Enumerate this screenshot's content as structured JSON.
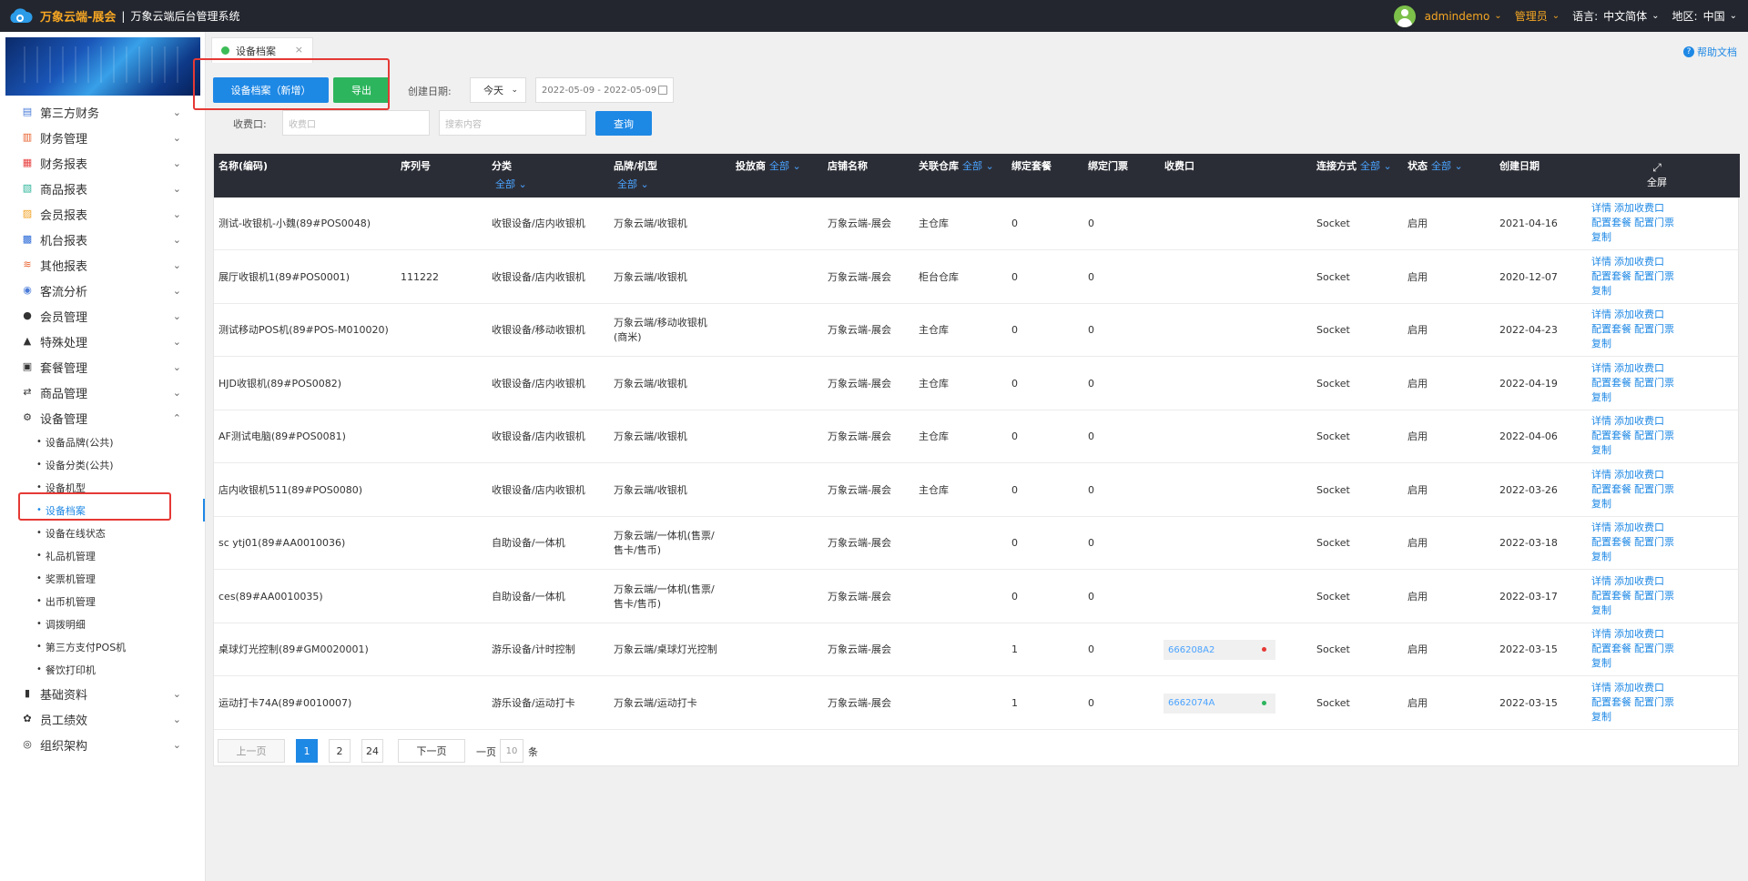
{
  "header": {
    "brand": "万象云端-展会",
    "separator": "|",
    "system_name": "万象云端后台管理系统",
    "username": "admindemo",
    "role": "管理员",
    "language_label": "语言:",
    "language": "中文简体",
    "region_label": "地区:",
    "region": "中国"
  },
  "sidebar": {
    "items": [
      {
        "label": "第三方财务",
        "icon": "document-icon",
        "color": "#4a7bd8"
      },
      {
        "label": "财务管理",
        "icon": "ledger-icon",
        "color": "#e8602c"
      },
      {
        "label": "财务报表",
        "icon": "report-icon",
        "color": "#e84040"
      },
      {
        "label": "商品报表",
        "icon": "product-report-icon",
        "color": "#2db59a"
      },
      {
        "label": "会员报表",
        "icon": "member-report-icon",
        "color": "#f0a020"
      },
      {
        "label": "机台报表",
        "icon": "machine-report-icon",
        "color": "#2c6bd8"
      },
      {
        "label": "其他报表",
        "icon": "layers-icon",
        "color": "#e8602c"
      },
      {
        "label": "客流分析",
        "icon": "target-icon",
        "color": "#4a7bd8"
      },
      {
        "label": "会员管理",
        "icon": "user-icon",
        "color": "#333"
      },
      {
        "label": "特殊处理",
        "icon": "warning-icon",
        "color": "#333"
      },
      {
        "label": "套餐管理",
        "icon": "package-icon",
        "color": "#333"
      },
      {
        "label": "商品管理",
        "icon": "swap-icon",
        "color": "#333"
      },
      {
        "label": "设备管理",
        "icon": "device-icon",
        "color": "#333"
      }
    ],
    "sub_items": [
      "设备品牌(公共)",
      "设备分类(公共)",
      "设备机型",
      "设备档案",
      "设备在线状态",
      "礼品机管理",
      "奖票机管理",
      "出币机管理",
      "调拨明细",
      "第三方支付POS机",
      "餐饮打印机"
    ],
    "bottom_items": [
      {
        "label": "基础资料",
        "icon": "book-icon"
      },
      {
        "label": "员工绩效",
        "icon": "gear-icon"
      },
      {
        "label": "组织架构",
        "icon": "org-icon"
      }
    ]
  },
  "tabs": {
    "active": "设备档案",
    "close": "×"
  },
  "help": "帮助文档",
  "toolbar": {
    "add_label": "设备档案（新增）",
    "export_label": "导出",
    "created_label": "创建日期:",
    "date_preset": "今天",
    "date_range": "2022-05-09 - 2022-05-09",
    "port_label": "收费口:",
    "port_placeholder": "收费口",
    "search_placeholder": "搜索内容",
    "query_label": "查询"
  },
  "table": {
    "headers": {
      "name": "名称(编码)",
      "serial": "序列号",
      "category": "分类",
      "brand": "品牌/机型",
      "operator": "投放商",
      "store": "店铺名称",
      "warehouse": "关联仓库",
      "bind_package": "绑定套餐",
      "bind_ticket": "绑定门票",
      "port": "收费口",
      "conn": "连接方式",
      "status": "状态",
      "created": "创建日期",
      "fullscreen": "全屏",
      "all": "全部"
    },
    "rows": [
      {
        "name": "测试-收银机-小魏(89#POS0048)",
        "serial": "",
        "category": "收银设备/店内收银机",
        "brand": "万象云端/收银机",
        "store": "万象云端-展会",
        "warehouse": "主仓库",
        "pkg": "0",
        "ticket": "0",
        "port": "",
        "conn": "Socket",
        "status": "启用",
        "created": "2021-04-16"
      },
      {
        "name": "展厅收银机1(89#POS0001)",
        "serial": "111222",
        "category": "收银设备/店内收银机",
        "brand": "万象云端/收银机",
        "store": "万象云端-展会",
        "warehouse": "柜台仓库",
        "pkg": "0",
        "ticket": "0",
        "port": "",
        "conn": "Socket",
        "status": "启用",
        "created": "2020-12-07"
      },
      {
        "name": "测试移动POS机(89#POS-M010020)",
        "serial": "",
        "category": "收银设备/移动收银机",
        "brand": "万象云端/移动收银机\n(商米)",
        "store": "万象云端-展会",
        "warehouse": "主仓库",
        "pkg": "0",
        "ticket": "0",
        "port": "",
        "conn": "Socket",
        "status": "启用",
        "created": "2022-04-23"
      },
      {
        "name": "HJD收银机(89#POS0082)",
        "serial": "",
        "category": "收银设备/店内收银机",
        "brand": "万象云端/收银机",
        "store": "万象云端-展会",
        "warehouse": "主仓库",
        "pkg": "0",
        "ticket": "0",
        "port": "",
        "conn": "Socket",
        "status": "启用",
        "created": "2022-04-19"
      },
      {
        "name": "AF测试电脑(89#POS0081)",
        "serial": "",
        "category": "收银设备/店内收银机",
        "brand": "万象云端/收银机",
        "store": "万象云端-展会",
        "warehouse": "主仓库",
        "pkg": "0",
        "ticket": "0",
        "port": "",
        "conn": "Socket",
        "status": "启用",
        "created": "2022-04-06"
      },
      {
        "name": "店内收银机511(89#POS0080)",
        "serial": "",
        "category": "收银设备/店内收银机",
        "brand": "万象云端/收银机",
        "store": "万象云端-展会",
        "warehouse": "主仓库",
        "pkg": "0",
        "ticket": "0",
        "port": "",
        "conn": "Socket",
        "status": "启用",
        "created": "2022-03-26"
      },
      {
        "name": "sc ytj01(89#AA0010036)",
        "serial": "",
        "category": "自助设备/一体机",
        "brand": "万象云端/一体机(售票/\n售卡/售币)",
        "store": "万象云端-展会",
        "warehouse": "",
        "pkg": "0",
        "ticket": "0",
        "port": "",
        "conn": "Socket",
        "status": "启用",
        "created": "2022-03-18"
      },
      {
        "name": "ces(89#AA0010035)",
        "serial": "",
        "category": "自助设备/一体机",
        "brand": "万象云端/一体机(售票/\n售卡/售币)",
        "store": "万象云端-展会",
        "warehouse": "",
        "pkg": "0",
        "ticket": "0",
        "port": "",
        "conn": "Socket",
        "status": "启用",
        "created": "2022-03-17"
      },
      {
        "name": "桌球灯光控制(89#GM0020001)",
        "serial": "",
        "category": "游乐设备/计时控制",
        "brand": "万象云端/桌球灯光控制",
        "store": "万象云端-展会",
        "warehouse": "",
        "pkg": "1",
        "ticket": "0",
        "port": "666208A2",
        "port_dot": "#e53935",
        "conn": "Socket",
        "status": "启用",
        "created": "2022-03-15"
      },
      {
        "name": "运动打卡74A(89#0010007)",
        "serial": "",
        "category": "游乐设备/运动打卡",
        "brand": "万象云端/运动打卡",
        "store": "万象云端-展会",
        "warehouse": "",
        "pkg": "1",
        "ticket": "0",
        "port": "6662074A",
        "port_dot": "#2db55d",
        "conn": "Socket",
        "status": "启用",
        "created": "2022-03-15"
      }
    ],
    "actions": {
      "detail": "详情",
      "add_port": "添加收费口",
      "config_package": "配置套餐",
      "config_ticket": "配置门票",
      "copy": "复制"
    }
  },
  "pagination": {
    "prev": "上一页",
    "pages": [
      "1",
      "2",
      "24"
    ],
    "next": "下一页",
    "per_page_label": "一页",
    "per_page": "10",
    "unit": "条"
  }
}
